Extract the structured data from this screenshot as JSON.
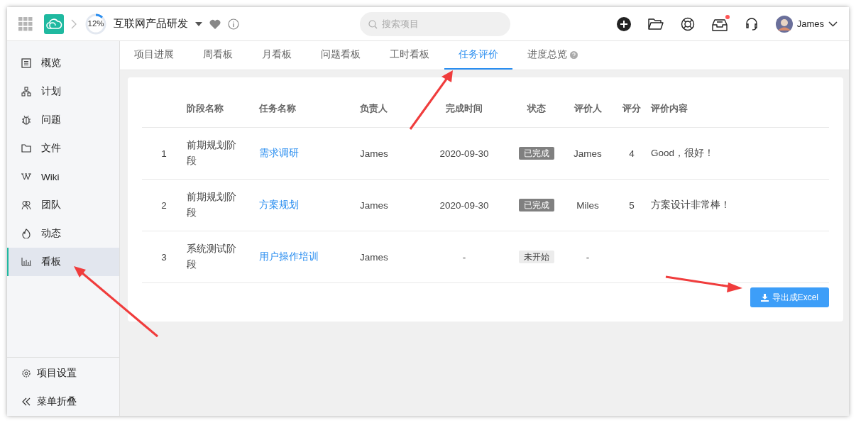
{
  "header": {
    "progress": {
      "label": "12%",
      "level": 0.12
    },
    "project_name": "互联网产品研发",
    "search": {
      "placeholder": "搜索项目"
    },
    "notification_dot": true,
    "user": {
      "name": "James"
    }
  },
  "sidebar": {
    "items": [
      {
        "label": "概览",
        "selected": false
      },
      {
        "label": "计划",
        "selected": false
      },
      {
        "label": "问题",
        "selected": false
      },
      {
        "label": "文件",
        "selected": false
      },
      {
        "label": "Wiki",
        "selected": false
      },
      {
        "label": "团队",
        "selected": false
      },
      {
        "label": "动态",
        "selected": false
      },
      {
        "label": "看板",
        "selected": true
      }
    ],
    "footer": [
      {
        "label": "项目设置"
      },
      {
        "label": "菜单折叠"
      }
    ]
  },
  "tabs": [
    {
      "label": "项目进展",
      "selected": false
    },
    {
      "label": "周看板",
      "selected": false
    },
    {
      "label": "月看板",
      "selected": false
    },
    {
      "label": "问题看板",
      "selected": false
    },
    {
      "label": "工时看板",
      "selected": false
    },
    {
      "label": "任务评价",
      "selected": true
    },
    {
      "label": "进度总览",
      "selected": false,
      "help": true
    }
  ],
  "table": {
    "columns": [
      "阶段名称",
      "任务名称",
      "负责人",
      "完成时间",
      "状态",
      "评价人",
      "评分",
      "评价内容"
    ],
    "rows": [
      {
        "index": "1",
        "stage": "前期规划阶段",
        "task": "需求调研",
        "owner": "James",
        "finished": "2020-09-30",
        "status": "已完成",
        "done": true,
        "reviewer": "James",
        "score": "4",
        "comment": "Good，很好！"
      },
      {
        "index": "2",
        "stage": "前期规划阶段",
        "task": "方案规划",
        "owner": "James",
        "finished": "2020-09-30",
        "status": "已完成",
        "done": true,
        "reviewer": "Miles",
        "score": "5",
        "comment": "方案设计非常棒！"
      },
      {
        "index": "3",
        "stage": "系统测试阶段",
        "task": "用户操作培训",
        "owner": "James",
        "finished": "-",
        "status": "未开始",
        "done": false,
        "reviewer": "-"
      }
    ]
  },
  "export_button": "导出成Excel"
}
